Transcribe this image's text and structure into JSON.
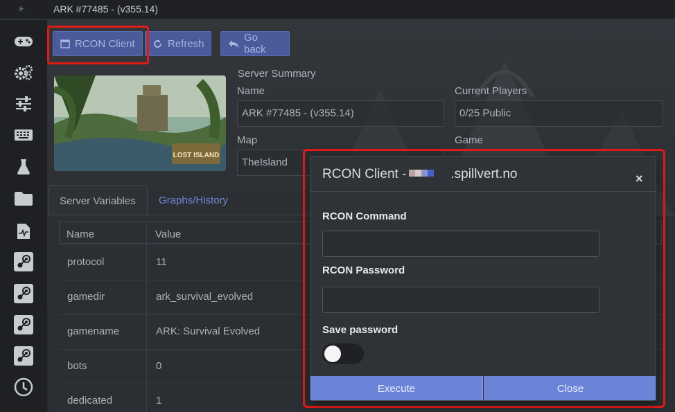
{
  "window": {
    "title": "ARK #77485 - (v355.14)"
  },
  "sidebar": {
    "icons": [
      "gamepad-icon",
      "gears-icon",
      "sliders-icon",
      "keyboard-icon",
      "flask-icon",
      "folder-icon",
      "file-pulse-icon",
      "steam-icon",
      "steam-icon",
      "steam-icon",
      "steam-icon",
      "clock-icon"
    ]
  },
  "toolbar": {
    "rcon_label": "RCON Client",
    "refresh_label": "Refresh",
    "goback_label": "Go back"
  },
  "summary": {
    "title": "Server Summary",
    "name_label": "Name",
    "name_value": "ARK #77485 - (v355.14)",
    "players_label": "Current Players",
    "players_value": "0/25 Public",
    "map_label": "Map",
    "map_value": "TheIsland",
    "game_label": "Game",
    "image_text": "LOST ISLAND"
  },
  "tabs": {
    "active": "Server Variables",
    "other": "Graphs/History"
  },
  "table": {
    "headers": [
      "Name",
      "Value"
    ],
    "rows": [
      {
        "name": "protocol",
        "value": "11"
      },
      {
        "name": "gamedir",
        "value": "ark_survival_evolved"
      },
      {
        "name": "gamename",
        "value": "ARK: Survival Evolved"
      },
      {
        "name": "bots",
        "value": "0"
      },
      {
        "name": "dedicated",
        "value": "1"
      }
    ]
  },
  "modal": {
    "title_prefix": "RCON Client -",
    "title_suffix": ".spillvert.no",
    "command_label": "RCON Command",
    "password_label": "RCON Password",
    "save_label": "Save password",
    "save_password": false,
    "execute_label": "Execute",
    "close_label": "Close",
    "close_glyph": "×"
  },
  "colors": {
    "accent": "#6b84d8",
    "highlight": "#e31b17",
    "toolbar_button": "#4a5a9a"
  }
}
